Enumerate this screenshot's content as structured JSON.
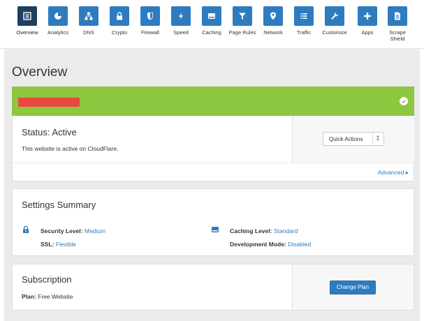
{
  "nav": {
    "items": [
      {
        "label": "Overview",
        "icon": "overview-icon",
        "active": true
      },
      {
        "label": "Analytics",
        "icon": "analytics-icon"
      },
      {
        "label": "DNS",
        "icon": "dns-icon"
      },
      {
        "label": "Crypto",
        "icon": "lock-icon"
      },
      {
        "label": "Firewall",
        "icon": "shield-icon"
      },
      {
        "label": "Speed",
        "icon": "lightning-icon"
      },
      {
        "label": "Caching",
        "icon": "server-icon"
      },
      {
        "label": "Page Rules",
        "icon": "filter-icon"
      },
      {
        "label": "Network",
        "icon": "location-pin-icon"
      },
      {
        "label": "Traffic",
        "icon": "list-icon"
      },
      {
        "label": "Customize",
        "icon": "wrench-icon"
      },
      {
        "label": "Apps",
        "icon": "plus-icon"
      },
      {
        "label": "Scrape Shield",
        "icon": "document-icon"
      }
    ]
  },
  "page": {
    "title": "Overview"
  },
  "colors": {
    "accent": "#2f7bbf",
    "active_nav": "#1d3f60",
    "banner_green": "#8dc63f",
    "redacted_red": "#e8493f"
  },
  "status": {
    "title": "Status: Active",
    "description": "This website is active on CloudFlare.",
    "quick_actions_label": "Quick Actions",
    "advanced_label": "Advanced ▸"
  },
  "settings": {
    "title": "Settings Summary",
    "security_level_label": "Security Level:",
    "security_level_value": "Medium",
    "ssl_label": "SSL:",
    "ssl_value": "Flexible",
    "caching_level_label": "Caching Level:",
    "caching_level_value": "Standard",
    "dev_mode_label": "Development Mode:",
    "dev_mode_value": "Disabled"
  },
  "subscription": {
    "title": "Subscription",
    "plan_label": "Plan:",
    "plan_value": "Free Website",
    "change_plan_label": "Change Plan"
  }
}
